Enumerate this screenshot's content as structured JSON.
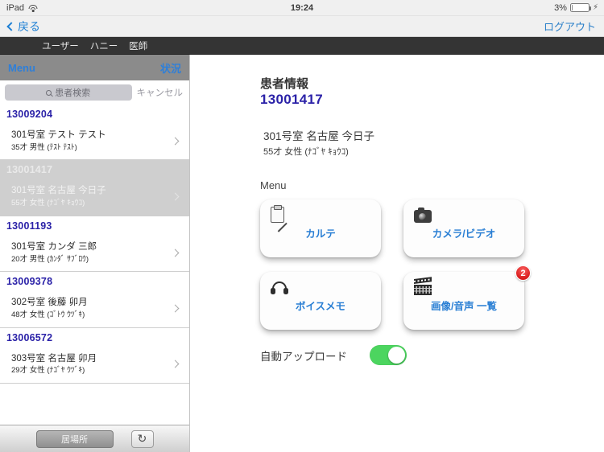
{
  "status_bar": {
    "device": "iPad",
    "wifi_icon": "wifi-icon",
    "time": "19:24",
    "battery_percent": "3%",
    "charging_icon": "lightning-bolt-icon"
  },
  "navbar": {
    "back_label": "戻る",
    "back_icon": "chevron-left-icon",
    "logout_label": "ログアウト"
  },
  "userbar": {
    "role_label": "ユーザー",
    "user_name": "ハニー",
    "user_title": "医師"
  },
  "sidebar": {
    "toolbar": {
      "menu_label": "Menu",
      "status_label": "状況"
    },
    "search": {
      "placeholder": "患者検索",
      "search_icon": "search-icon",
      "cancel_label": "キャンセル"
    },
    "patients": [
      {
        "id": "13009204",
        "room_and_name": "301号室  テスト テスト",
        "age_gender_kana": "35才 男性 (ﾃｽﾄ ﾃｽﾄ)",
        "selected": false
      },
      {
        "id": "13001417",
        "room_and_name": "301号室  名古屋 今日子",
        "age_gender_kana": "55才 女性 (ﾅｺﾞﾔ ｷｮｳｺ)",
        "selected": true
      },
      {
        "id": "13001193",
        "room_and_name": "301号室  カンダ 三郎",
        "age_gender_kana": "20才 男性 (ｶﾝﾀﾞ ｻﾌﾞﾛｳ)",
        "selected": false
      },
      {
        "id": "13009378",
        "room_and_name": "302号室  後藤 卯月",
        "age_gender_kana": "48才 女性 (ｺﾞﾄｳ ｳﾂﾞｷ)",
        "selected": false
      },
      {
        "id": "13006572",
        "room_and_name": "303号室  名古屋 卯月",
        "age_gender_kana": "29才 女性 (ﾅｺﾞﾔ ｳﾂﾞｷ)",
        "selected": false
      }
    ],
    "bottom_toolbar": {
      "location_label": "居場所",
      "refresh_icon": "refresh-icon",
      "refresh_glyph": "↻"
    }
  },
  "main": {
    "title": "患者情報",
    "patient_id": "13001417",
    "patient_room_name": "301号室  名古屋 今日子",
    "patient_age_gender_kana": "55才 女性 (ﾅｺﾞﾔ ｷｮｳｺ)",
    "menu_label": "Menu",
    "cards": [
      {
        "label": "カルテ",
        "icon": "clipboard-pencil-icon",
        "badge": null
      },
      {
        "label": "カメラ/ビデオ",
        "icon": "camera-icon",
        "badge": null
      },
      {
        "label": "ボイスメモ",
        "icon": "headphones-icon",
        "badge": null
      },
      {
        "label": "画像/音声 一覧",
        "icon": "film-clapper-icon",
        "badge": "2"
      }
    ],
    "auto_upload": {
      "label": "自動アップロード",
      "enabled": true
    }
  },
  "colors": {
    "accent_blue": "#2a7fd4",
    "id_purple": "#2b22a8",
    "toggle_green": "#4cd55f",
    "badge_red": "#d91b1b",
    "dark_bar": "#343434"
  }
}
